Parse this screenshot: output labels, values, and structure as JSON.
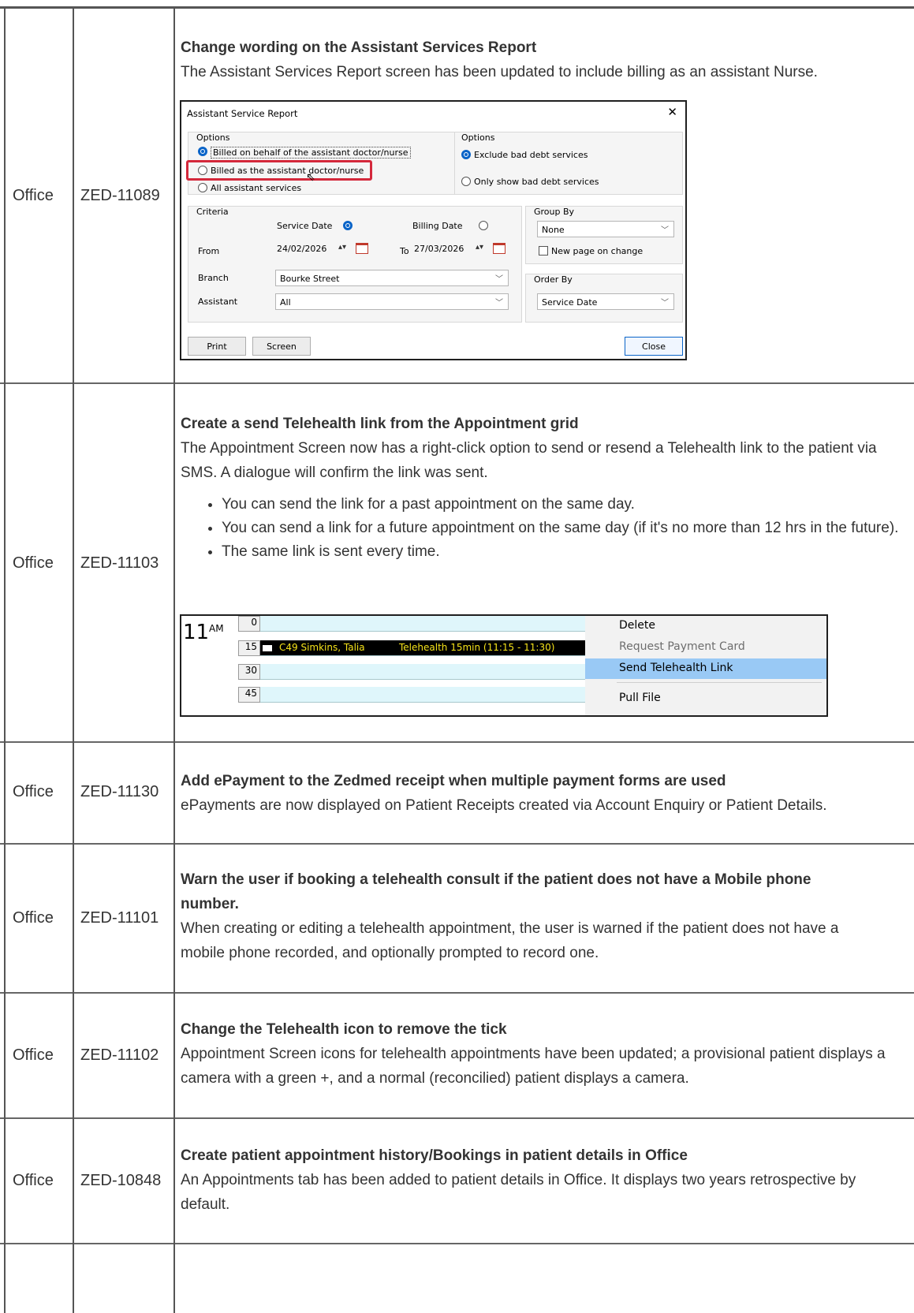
{
  "rows": [
    {
      "product": "Office",
      "id": "ZED-11089",
      "title": "Change wording on the Assistant Services Report",
      "text": "The Assistant Services Report screen has been updated to include billing as an assistant Nurse."
    },
    {
      "product": "Office",
      "id": "ZED-11103",
      "title": "Create a send Telehealth link from the Appointment grid",
      "text": "The Appointment Screen now has a right-click option to send or resend a Telehealth link to the patient via SMS. A dialogue will confirm the link was sent.",
      "bullets": [
        "You can send the link for a past appointment on the same day.",
        "You can send a link for a future appointment on the same day (if it's no more than 12 hrs in the future).",
        "The same link is sent every time."
      ]
    },
    {
      "product": "Office",
      "id": "ZED-11130",
      "title": "Add ePayment to the Zedmed receipt when multiple payment forms are used",
      "text": "ePayments are now displayed on Patient Receipts created via Account Enquiry or Patient Details."
    },
    {
      "product": "Office",
      "id": "ZED-11101",
      "title": "Warn the user if booking a telehealth consult if the patient does not have a Mobile phone number.",
      "text": "When creating or editing a telehealth appointment, the user is warned if the patient does not have a mobile phone recorded, and optionally prompted to record one."
    },
    {
      "product": "Office",
      "id": "ZED-11102",
      "title": "Change the Telehealth icon to remove the tick",
      "text": "Appointment Screen icons for telehealth appointments have been updated; a provisional patient displays a camera with a green +, and a normal (reconcilied) patient displays a camera."
    },
    {
      "product": "Office",
      "id": "ZED-10848",
      "title": "Create patient appointment history/Bookings in patient details in Office",
      "text": "An Appointments tab has been added to patient details in Office. It displays two years retrospective by default."
    }
  ],
  "dialog": {
    "title": "Assistant Service Report",
    "close_glyph": "✕",
    "options_left_label": "Options",
    "radio_billed_on_behalf": "Billed on behalf of the assistant doctor/nurse",
    "radio_billed_as": "Billed as the assistant doctor/nurse",
    "radio_all": "All assistant services",
    "options_right_label": "Options",
    "radio_exclude_bad_debt": "Exclude bad debt services",
    "radio_only_bad_debt": "Only show bad debt services",
    "criteria_label": "Criteria",
    "service_date_label": "Service Date",
    "billing_date_label": "Billing Date",
    "from_label": "From",
    "from_value": "24/02/2026",
    "to_label": "To",
    "to_value": "27/03/2026",
    "branch_label": "Branch",
    "branch_value": "Bourke Street",
    "assistant_label": "Assistant",
    "assistant_value": "All",
    "group_by_label": "Group By",
    "group_by_value": "None",
    "new_page_label": "New page on change",
    "order_by_label": "Order By",
    "order_by_value": "Service Date",
    "print_label": "Print",
    "screen_label": "Screen",
    "close_label": "Close"
  },
  "grid": {
    "hour": "11",
    "ampm": "AM",
    "minutes": [
      "0",
      "15",
      "30",
      "45"
    ],
    "appointment_patient": "C49 Simkins, Talia",
    "appointment_detail": "Telehealth 15min (11:15 - 11:30)",
    "menu": [
      "Delete",
      "Request Payment Card",
      "Send Telehealth Link",
      "Pull File"
    ]
  },
  "colors": {
    "border": "#555555",
    "text": "#333333",
    "highlight": "#d4283b",
    "menu_selected": "#99c9f5",
    "slot": "#dff6fb",
    "appointment_text": "#f5e21a"
  }
}
